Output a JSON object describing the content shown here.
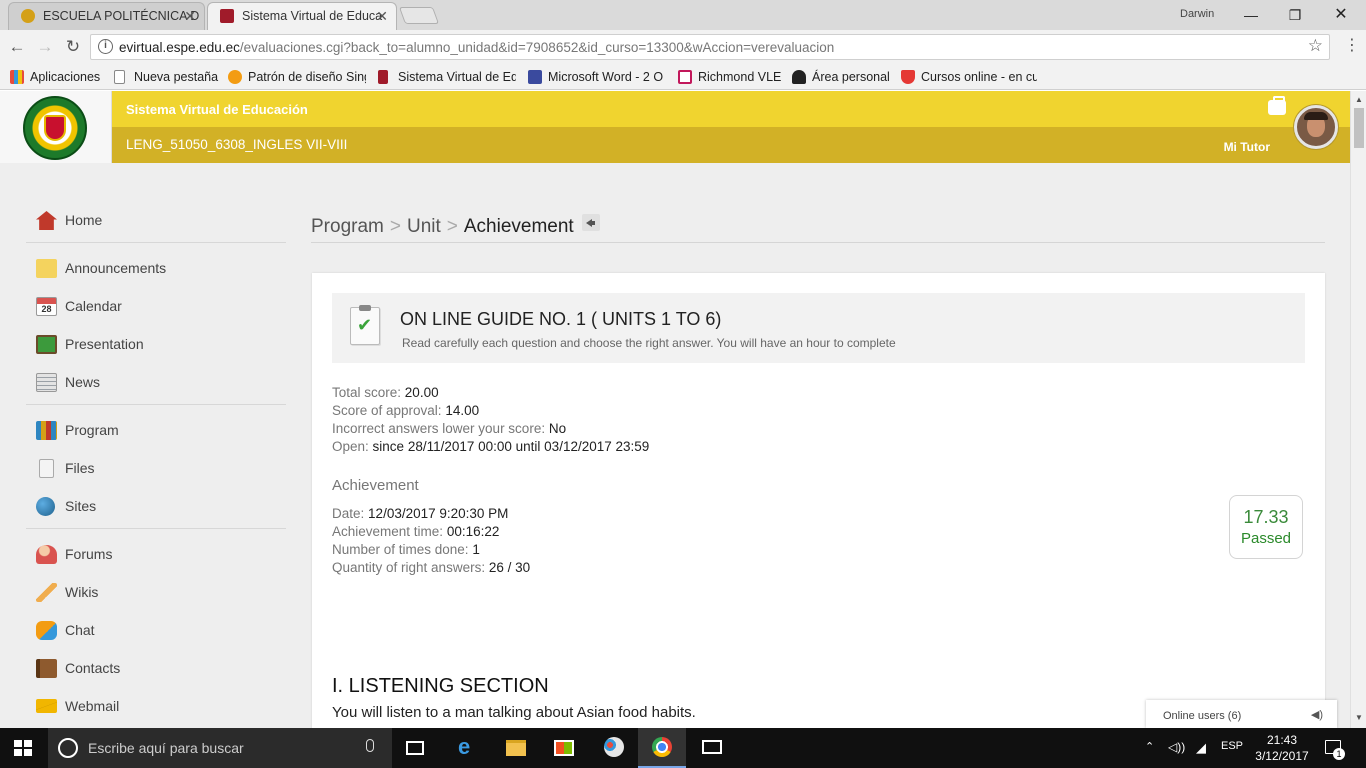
{
  "browser": {
    "tabs": [
      {
        "title": "ESCUELA POLITÉCNICA D",
        "active": false
      },
      {
        "title": "Sistema Virtual de Educa",
        "active": true
      }
    ],
    "profile": "Darwin",
    "url_domain": "evirtual.espe.edu.ec",
    "url_path": "/evaluaciones.cgi?back_to=alumno_unidad&id=7908652&id_curso=13300&wAccion=verevaluacion",
    "bookmarks": [
      {
        "label": "Aplicaciones",
        "icon": "apps-grid-icon"
      },
      {
        "label": "Nueva pestaña",
        "icon": "page-icon"
      },
      {
        "label": "Patrón de diseño Sing",
        "icon": "sun-icon"
      },
      {
        "label": "Sistema Virtual de Ed",
        "icon": "espe-icon"
      },
      {
        "label": "Microsoft Word - 2 O",
        "icon": "building-icon"
      },
      {
        "label": "Richmond VLE",
        "icon": "richmond-icon"
      },
      {
        "label": "Área personal",
        "icon": "graduate-icon"
      },
      {
        "label": "Cursos online - en cu",
        "icon": "udemy-icon"
      }
    ]
  },
  "header": {
    "site_title": "Sistema Virtual de Educación",
    "course": "LENG_51050_6308_INGLES VII-VIII",
    "tutor_label": "Mi Tutor"
  },
  "sidebar": {
    "groups": [
      [
        {
          "label": "Home",
          "icon": "home-icon",
          "color": "#c0392b"
        }
      ],
      [
        {
          "label": "Announcements",
          "icon": "sticky-note-icon",
          "color": "#f4d35e"
        },
        {
          "label": "Calendar",
          "icon": "calendar-icon",
          "color": "#d9534f"
        },
        {
          "label": "Presentation",
          "icon": "presentation-icon",
          "color": "#3c9a3c"
        },
        {
          "label": "News",
          "icon": "newspaper-icon",
          "color": "#9aa0a6"
        }
      ],
      [
        {
          "label": "Program",
          "icon": "binders-icon",
          "color": "#d4a017"
        },
        {
          "label": "Files",
          "icon": "file-icon",
          "color": "#c8c8c8"
        },
        {
          "label": "Sites",
          "icon": "globe-icon",
          "color": "#2e86c1"
        }
      ],
      [
        {
          "label": "Forums",
          "icon": "forum-people-icon",
          "color": "#d9534f"
        },
        {
          "label": "Wikis",
          "icon": "pencil-icon",
          "color": "#f0ad4e"
        },
        {
          "label": "Chat",
          "icon": "chat-bubbles-icon",
          "color": "#f39c12"
        },
        {
          "label": "Contacts",
          "icon": "address-book-icon",
          "color": "#8e5a2e"
        },
        {
          "label": "Webmail",
          "icon": "envelope-icon",
          "color": "#f1b600"
        }
      ]
    ]
  },
  "breadcrumb": {
    "items": [
      "Program",
      "Unit"
    ],
    "separator": ">",
    "current": "Achievement"
  },
  "evaluation": {
    "title": "ON LINE GUIDE NO. 1 ( UNITS 1 TO 6)",
    "description": "Read carefully each question and choose the right answer. You will have an hour to complete",
    "details": [
      {
        "label": "Total score:",
        "value": "20.00"
      },
      {
        "label": "Score of approval:",
        "value": "14.00"
      },
      {
        "label": "Incorrect answers lower your score:",
        "value": "No"
      },
      {
        "label": "Open:",
        "value": "since 28/11/2017 00:00 until 03/12/2017 23:59"
      }
    ],
    "achievement_heading": "Achievement",
    "achievement": [
      {
        "label": "Date:",
        "value": "12/03/2017 9:20:30 PM"
      },
      {
        "label": "Achievement time:",
        "value": "00:16:22"
      },
      {
        "label": "Number of times done:",
        "value": "1"
      },
      {
        "label": "Quantity of right answers:",
        "value": "26 / 30"
      }
    ],
    "score": "17.33",
    "status": "Passed",
    "status_color": "#2b8a2b"
  },
  "section": {
    "title": "I. LISTENING SECTION",
    "description": "You will listen to a man talking about Asian food habits."
  },
  "online_users": "Online users (6)",
  "taskbar": {
    "search_placeholder": "Escribe aquí para buscar",
    "language": "ESP",
    "time": "21:43",
    "date": "3/12/2017",
    "notification_count": "1"
  }
}
